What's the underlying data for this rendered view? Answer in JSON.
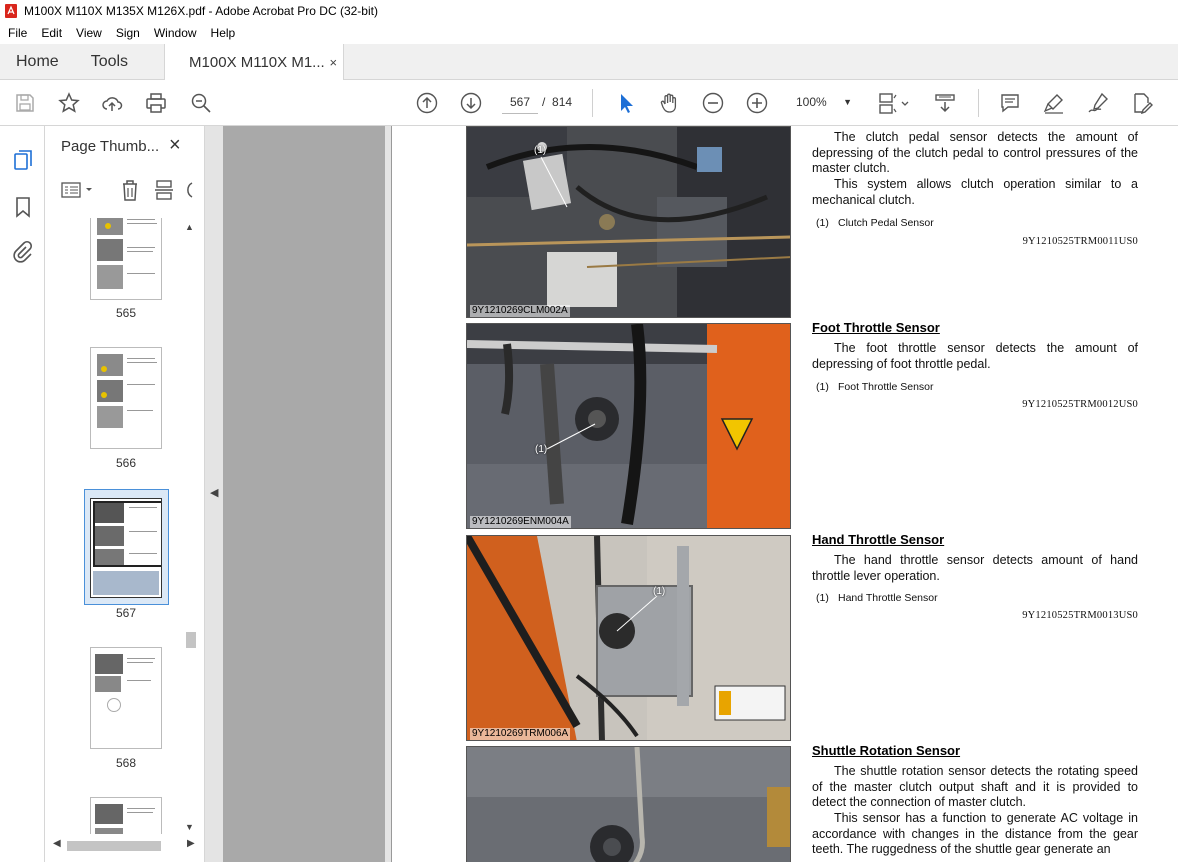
{
  "window": {
    "title": "M100X M110X M135X M126X.pdf - Adobe Acrobat Pro DC (32-bit)"
  },
  "menu": [
    "File",
    "Edit",
    "View",
    "Sign",
    "Window",
    "Help"
  ],
  "tabs": {
    "home": "Home",
    "tools": "Tools",
    "document": "M100X M110X M1...",
    "close": "×"
  },
  "toolbar": {
    "page_current": "567",
    "page_sep": "/",
    "page_total": "814",
    "zoom": "100%",
    "icons": [
      "save-icon",
      "bookmark-star-icon",
      "upload-icon",
      "print-icon",
      "search-zoom-icon",
      "page-up-icon",
      "page-down-icon",
      "select-cursor-icon",
      "hand-icon",
      "zoom-out-icon",
      "zoom-in-icon",
      "page-fit-icon",
      "scroll-mode-icon",
      "comment-icon",
      "highlight-icon",
      "sign-icon",
      "edit-pdf-icon"
    ]
  },
  "thumbnails": {
    "title": "Page Thumb...",
    "close": "×",
    "pages": [
      {
        "label": "565"
      },
      {
        "label": "566"
      },
      {
        "label": "567",
        "selected": true
      },
      {
        "label": "568"
      }
    ]
  },
  "document": {
    "sections": [
      {
        "title": "",
        "paragraphs": [
          "The clutch pedal sensor detects the amount of depressing of the clutch pedal to control pressures of the master clutch.",
          "This system allows clutch operation similar to a mechanical clutch."
        ],
        "note_num": "(1)",
        "note_text": "Clutch Pedal Sensor",
        "ref": "9Y1210525TRM0011US0",
        "photo_code": "9Y1210269CLM002A",
        "callout": "(1)"
      },
      {
        "title": "Foot Throttle Sensor",
        "paragraphs": [
          "The foot throttle sensor detects the amount of depressing of foot throttle pedal."
        ],
        "note_num": "(1)",
        "note_text": "Foot Throttle Sensor",
        "ref": "9Y1210525TRM0012US0",
        "photo_code": "9Y1210269ENM004A",
        "callout": "(1)"
      },
      {
        "title": "Hand Throttle Sensor",
        "paragraphs": [
          "The hand throttle sensor detects amount of hand throttle lever operation."
        ],
        "note_num": "(1)",
        "note_text": "Hand Throttle Sensor",
        "ref": "9Y1210525TRM0013US0",
        "photo_code": "9Y1210269TRM006A",
        "callout": "(1)"
      },
      {
        "title": "Shuttle Rotation Sensor",
        "paragraphs": [
          "The shuttle rotation sensor detects the rotating speed of the master clutch output shaft and it is provided to detect the connection of master clutch.",
          "This sensor has a function to generate AC voltage in accordance with changes in the distance from the gear teeth. The ruggedness of the shuttle gear generate an"
        ]
      }
    ]
  },
  "colors": {
    "accent": "#4a90d9",
    "pdf_red": "#d9261c",
    "viewer_bg": "#e4e4e4",
    "orange_panel": "#e0611c"
  }
}
